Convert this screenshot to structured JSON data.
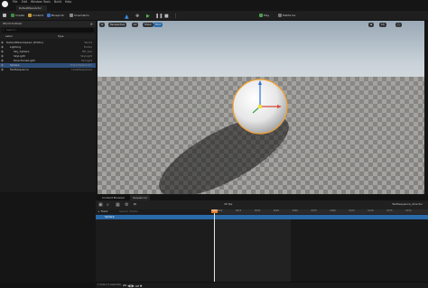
{
  "window": {
    "doc_tab": "DefaultPawnActor"
  },
  "menu": [
    "File",
    "Edit",
    "Window",
    "Tools",
    "Build",
    "Help"
  ],
  "toolbar": {
    "buttons": [
      {
        "label": "Create"
      },
      {
        "label": "Content"
      },
      {
        "label": "Blueprint"
      },
      {
        "label": "Cinematics"
      }
    ],
    "platforms_label": "Platforms",
    "settings_label": "Play"
  },
  "outliner": {
    "title": "World Outliner",
    "search_placeholder": "Search...",
    "col_label": "Label",
    "col_type": "Type",
    "rows": [
      {
        "label": "DefaultPawnSpawn (Editor)",
        "type": "World",
        "indent": 0,
        "selected": false
      },
      {
        "label": "Lighting",
        "type": "Folder",
        "indent": 1,
        "selected": false
      },
      {
        "label": "Sky_Sphere",
        "type": "BP_Sky",
        "indent": 2,
        "selected": false
      },
      {
        "label": "SkyLight",
        "type": "SkyLight",
        "indent": 2,
        "selected": false
      },
      {
        "label": "DirectionalLight",
        "type": "DirLight",
        "indent": 2,
        "selected": false
      },
      {
        "label": "Sphere",
        "type": "StaticMeshActor",
        "indent": 1,
        "selected": true
      },
      {
        "label": "TestSequence",
        "type": "LevelSequence",
        "indent": 1,
        "selected": false
      }
    ],
    "footer": ""
  },
  "viewport": {
    "perspective_label": "Perspective",
    "lit_label": "Lit",
    "show_label": "Show",
    "stats_label": "Pilot",
    "speed_label": "10"
  },
  "bottom": {
    "tabs": [
      {
        "label": "Content Browser",
        "active": false
      },
      {
        "label": "Sequencer",
        "active": true
      }
    ],
    "seq_name": "TestSequence_director",
    "track_name": "Sphere",
    "add_track": "+ Track",
    "search_placeholder": "Search Tracks",
    "fps": "30 fps",
    "ticks": [
      "0000",
      "0015",
      "0030",
      "0045",
      "0060",
      "0075",
      "0090",
      "0105",
      "0120",
      "0135",
      "0150"
    ],
    "current_frame": "0000",
    "status_text": "1 items (1 selected)"
  },
  "colors": {
    "accent": "#2a6aa8",
    "playhead": "#e07b2b",
    "gizmo_x": "#d64a3b",
    "gizmo_y": "#3aa045",
    "gizmo_z": "#2f6fd1",
    "sphere_outline": "#f2a12e"
  }
}
